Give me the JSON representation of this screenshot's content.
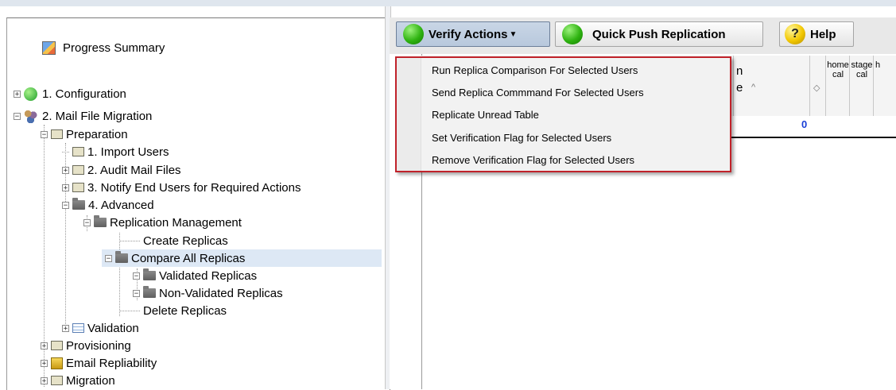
{
  "toolbar": {
    "verify_label": "Verify Actions",
    "quick_push_label": "Quick Push Replication",
    "help_label": "Help"
  },
  "menu": {
    "items": [
      "Run Replica Comparison For Selected Users",
      "Send Replica Commmand For Selected Users",
      "Replicate Unread Table",
      "Set Verification Flag for Selected Users",
      "Remove Verification Flag for Selected Users"
    ]
  },
  "grid": {
    "columns": [
      "home cal",
      "stage cal",
      "h"
    ],
    "row_value": "0"
  },
  "tree": {
    "progress_summary": "Progress Summary",
    "configuration": "1. Configuration",
    "mail_file_migration": "2. Mail File Migration",
    "preparation": "Preparation",
    "import_users": "1. Import Users",
    "audit_mail_files": "2. Audit Mail Files",
    "notify_end_users": "3. Notify End Users for Required Actions",
    "advanced": "4. Advanced",
    "replication_management": "Replication Management",
    "create_replicas": "Create Replicas",
    "compare_all_replicas": "Compare All Replicas",
    "validated_replicas": "Validated Replicas",
    "non_validated_replicas": "Non-Validated Replicas",
    "delete_replicas": "Delete Replicas",
    "validation": "Validation",
    "provisioning": "Provisioning",
    "email_repliability": "Email Repliability",
    "migration": "Migration"
  }
}
